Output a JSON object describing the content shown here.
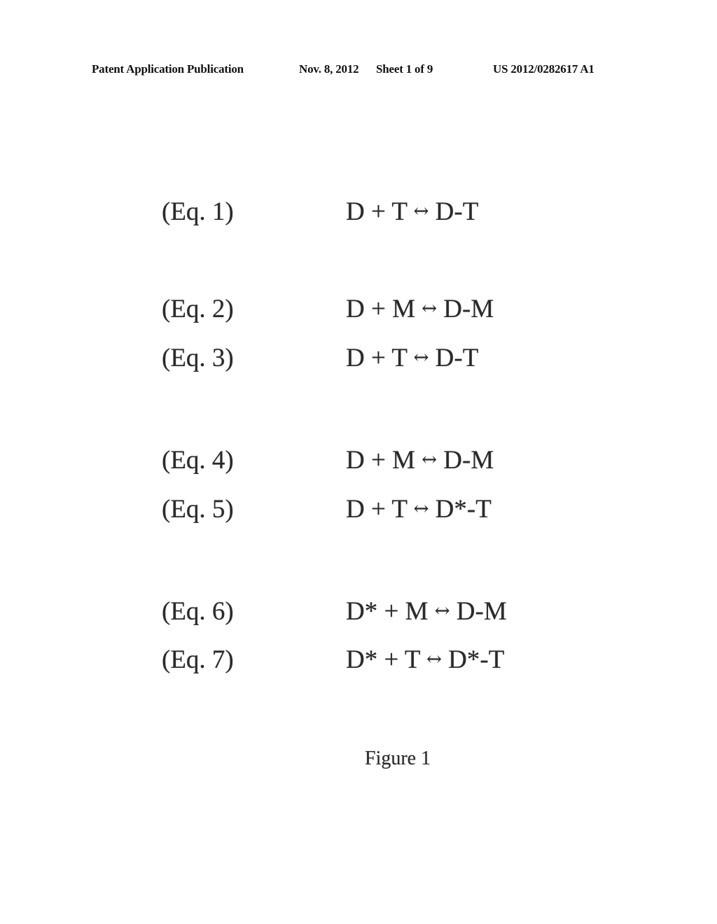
{
  "header": {
    "publication_type": "Patent Application Publication",
    "date": "Nov. 8, 2012",
    "sheet": "Sheet 1 of 9",
    "publication_number": "US 2012/0282617 A1"
  },
  "arrow_icon": "left-right-arrow",
  "arrow_glyph": "↔",
  "equations": [
    {
      "label": "(Eq. 1)",
      "lhs": "D + T",
      "rhs": "D-T"
    },
    {
      "label": "(Eq. 2)",
      "lhs": "D + M",
      "rhs": "D-M"
    },
    {
      "label": "(Eq. 3)",
      "lhs": "D + T",
      "rhs": "D-T"
    },
    {
      "label": "(Eq. 4)",
      "lhs": "D + M",
      "rhs": "D-M"
    },
    {
      "label": "(Eq. 5)",
      "lhs": "D + T",
      "rhs": "D*-T"
    },
    {
      "label": "(Eq. 6)",
      "lhs": "D* + M",
      "rhs": "D-M"
    },
    {
      "label": "(Eq. 7)",
      "lhs": "D* + T",
      "rhs": "D*-T"
    }
  ],
  "figure_caption": "Figure 1"
}
